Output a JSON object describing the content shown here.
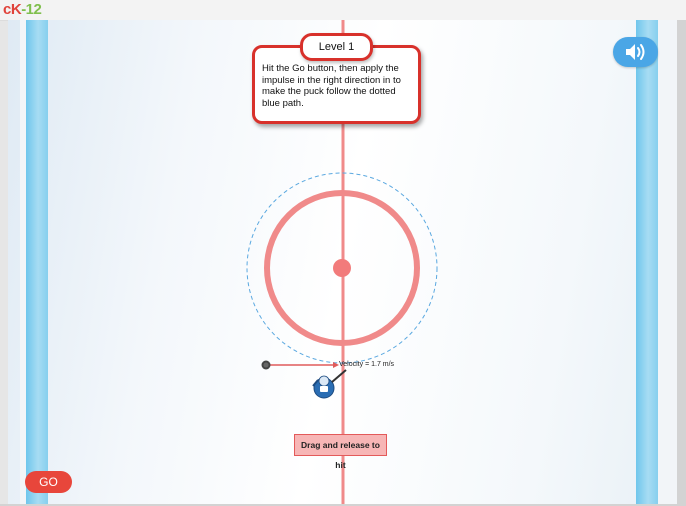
{
  "app": {
    "logo_prefix": "cK",
    "logo_suffix": "-12"
  },
  "level": {
    "label": "Level 1",
    "instructions": "Hit the Go button, then apply the impulse in the right direction in to make the puck follow the dotted blue path."
  },
  "hud": {
    "velocity_label": "Velocity = 1.7 m/s",
    "hint_label": "Drag and release to hit",
    "go_label": "GO"
  },
  "icons": {
    "sound": "speaker-volume-icon",
    "player": "hockey-player-icon",
    "puck": "puck-icon"
  },
  "colors": {
    "accent_red": "#e8463b",
    "rink_line": "#f08a8a",
    "rail_blue": "#86cfee",
    "path_blue": "#5aa8e0",
    "sound_button": "#4aa6e6"
  }
}
